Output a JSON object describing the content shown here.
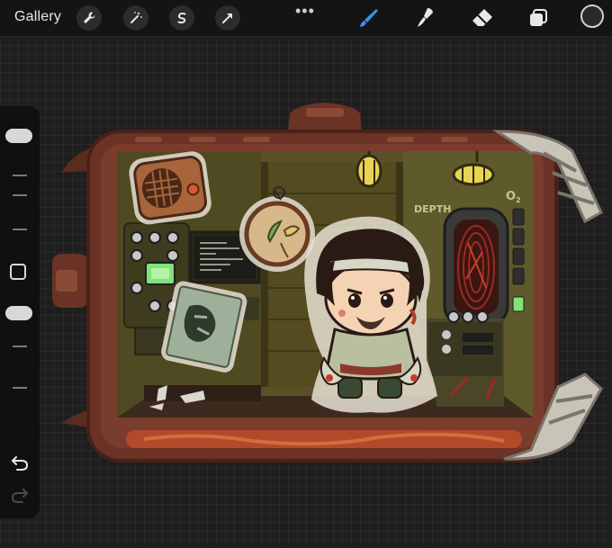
{
  "toolbar": {
    "gallery_label": "Gallery",
    "left_tools": [
      "wrench-icon",
      "magic-wand-icon",
      "selection-icon",
      "transform-arrow-icon"
    ],
    "more_label": "•••",
    "right_tools": [
      "brush-icon",
      "smudge-icon",
      "eraser-icon",
      "layers-icon"
    ],
    "active_tool": "brush-icon",
    "accent_color": "#3b8ee6",
    "current_color": "#2a2a2a"
  },
  "sidebar": {
    "brush_size_level": 0.95,
    "opacity_level": 0.95
  },
  "artwork": {
    "label_depth": "DEPTH",
    "label_o2": "O",
    "label_o2_sub": "2",
    "screen_lines": 6
  }
}
